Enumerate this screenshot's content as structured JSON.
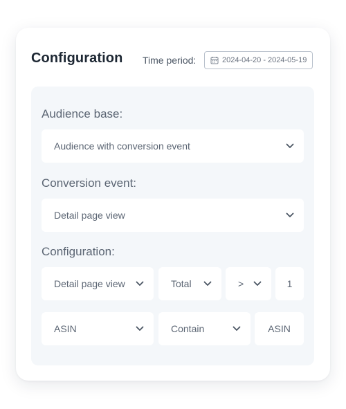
{
  "header": {
    "title": "Configuration",
    "time_period_label": "Time period:",
    "date_range": "2024-04-20 - 2024-05-19"
  },
  "audience_base": {
    "label": "Audience base:",
    "value": "Audience with conversion event"
  },
  "conversion_event": {
    "label": "Conversion event:",
    "value": "Detail page view"
  },
  "configuration": {
    "label": "Configuration:",
    "row1": {
      "event": "Detail page view",
      "aggregation": "Total",
      "operator": ">",
      "count": "1"
    },
    "row2": {
      "attribute": "ASIN",
      "match": "Contain",
      "value": "ASIN"
    }
  },
  "colors": {
    "text_primary": "#1d2733",
    "text_secondary": "#5b6573",
    "panel_bg": "#f4f7fa",
    "border": "#b9c1cc"
  }
}
